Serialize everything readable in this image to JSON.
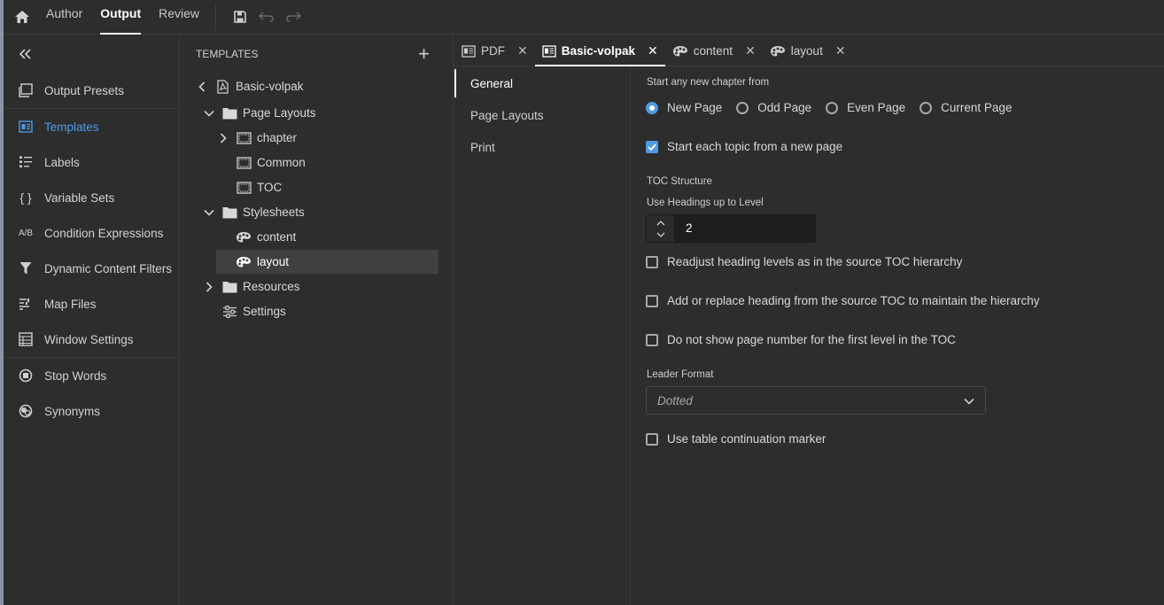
{
  "topbar": {
    "nav": [
      "Author",
      "Output",
      "Review"
    ],
    "active_nav": "Output"
  },
  "sidebar": {
    "items_group1": [
      {
        "label": "Output Presets",
        "icon": "output-presets-icon"
      }
    ],
    "items_group2": [
      {
        "label": "Templates",
        "icon": "templates-icon",
        "active": true
      },
      {
        "label": "Labels",
        "icon": "labels-icon"
      },
      {
        "label": "Variable Sets",
        "icon": "braces-icon"
      },
      {
        "label": "Condition Expressions",
        "icon": "ab-icon"
      },
      {
        "label": "Dynamic Content Filters",
        "icon": "filter-icon"
      },
      {
        "label": "Map Files",
        "icon": "map-files-icon"
      },
      {
        "label": "Window Settings",
        "icon": "window-settings-icon"
      }
    ],
    "items_group3": [
      {
        "label": "Stop Words",
        "icon": "stop-icon"
      },
      {
        "label": "Synonyms",
        "icon": "synonyms-icon"
      }
    ],
    "ab_glyph": "A/B",
    "braces_glyph": "{ }"
  },
  "tree": {
    "header": "TEMPLATES",
    "add_glyph": "+",
    "root": "Basic-volpak",
    "nodes": {
      "page_layouts": "Page Layouts",
      "chapter": "chapter",
      "common": "Common",
      "toc": "TOC",
      "stylesheets": "Stylesheets",
      "content": "content",
      "layout": "layout",
      "resources": "Resources",
      "settings": "Settings"
    }
  },
  "tabs": [
    {
      "label": "PDF",
      "icon": "pdf-doc-icon"
    },
    {
      "label": "Basic-volpak",
      "icon": "template-icon",
      "active": true
    },
    {
      "label": "content",
      "icon": "stylesheet-icon"
    },
    {
      "label": "layout",
      "icon": "stylesheet-icon"
    }
  ],
  "close_glyph": "✕",
  "subnav": [
    "General",
    "Page Layouts",
    "Print"
  ],
  "general": {
    "start_chapter_label": "Start any new chapter from",
    "radios": [
      "New Page",
      "Odd Page",
      "Even Page",
      "Current Page"
    ],
    "selected_radio": "New Page",
    "start_topic_label": "Start each topic from a new page",
    "start_topic_checked": true,
    "toc_structure_label": "TOC Structure",
    "headings_level_label": "Use Headings up to Level",
    "headings_level_value": "2",
    "readjust_label": "Readjust heading levels as in the source TOC hierarchy",
    "readjust_checked": false,
    "add_replace_label": "Add or replace heading from the source TOC to maintain the hierarchy",
    "add_replace_checked": false,
    "no_page_number_label": "Do not show page number for the first level in the TOC",
    "no_page_number_checked": false,
    "leader_format_label": "Leader Format",
    "leader_format_value": "Dotted",
    "table_marker_label": "Use table continuation marker",
    "table_marker_checked": false
  },
  "colors": {
    "accent": "#4d9be6",
    "background": "#2d2d2d",
    "selected_row": "#404040"
  }
}
